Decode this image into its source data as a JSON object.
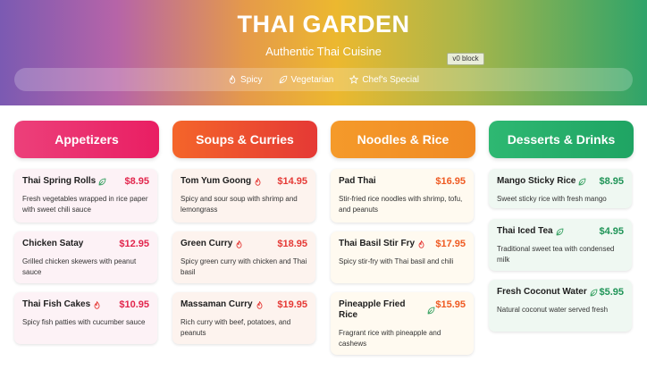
{
  "header": {
    "title": "THAI GARDEN",
    "subtitle": "Authentic Thai Cuisine",
    "block_tag": "v0 block",
    "filters": [
      {
        "label": "Spicy",
        "icon": "flame-icon"
      },
      {
        "label": "Vegetarian",
        "icon": "leaf-icon"
      },
      {
        "label": "Chef's Special",
        "icon": "star-icon"
      }
    ]
  },
  "colors": {
    "appetizers": "#e91e63",
    "soups": "#e53935",
    "noodles": "#f08a24",
    "desserts": "#1fa463"
  },
  "columns": [
    {
      "title": "Appetizers",
      "items": [
        {
          "name": "Thai Spring Rolls",
          "icon": "leaf-icon",
          "price": "$8.95",
          "desc": "Fresh vegetables wrapped in rice paper with sweet chili sauce"
        },
        {
          "name": "Chicken Satay",
          "icon": "",
          "price": "$12.95",
          "desc": "Grilled chicken skewers with peanut sauce"
        },
        {
          "name": "Thai Fish Cakes",
          "icon": "flame-icon",
          "price": "$10.95",
          "desc": "Spicy fish patties with cucumber sauce"
        }
      ]
    },
    {
      "title": "Soups & Curries",
      "items": [
        {
          "name": "Tom Yum Goong",
          "icon": "flame-icon",
          "price": "$14.95",
          "desc": "Spicy and sour soup with shrimp and lemongrass"
        },
        {
          "name": "Green Curry",
          "icon": "flame-icon",
          "price": "$18.95",
          "desc": "Spicy green curry with chicken and Thai basil"
        },
        {
          "name": "Massaman Curry",
          "icon": "flame-icon",
          "price": "$19.95",
          "desc": "Rich curry with beef, potatoes, and peanuts"
        }
      ]
    },
    {
      "title": "Noodles & Rice",
      "items": [
        {
          "name": "Pad Thai",
          "icon": "",
          "price": "$16.95",
          "desc": "Stir-fried rice noodles with shrimp, tofu, and peanuts"
        },
        {
          "name": "Thai Basil Stir Fry",
          "icon": "flame-icon",
          "price": "$17.95",
          "desc": "Spicy stir-fry with Thai basil and chili"
        },
        {
          "name": "Pineapple Fried Rice",
          "icon": "leaf-icon",
          "price": "$15.95",
          "desc": "Fragrant rice with pineapple and cashews"
        }
      ]
    },
    {
      "title": "Desserts & Drinks",
      "items": [
        {
          "name": "Mango Sticky Rice",
          "icon": "leaf-icon",
          "price": "$8.95",
          "desc": "Sweet sticky rice with fresh mango"
        },
        {
          "name": "Thai Iced Tea",
          "icon": "leaf-icon",
          "price": "$4.95",
          "desc": "Traditional sweet tea with condensed milk"
        },
        {
          "name": "Fresh Coconut Water",
          "icon": "leaf-icon",
          "price": "$5.95",
          "desc": "Natural coconut water served fresh"
        }
      ]
    }
  ]
}
